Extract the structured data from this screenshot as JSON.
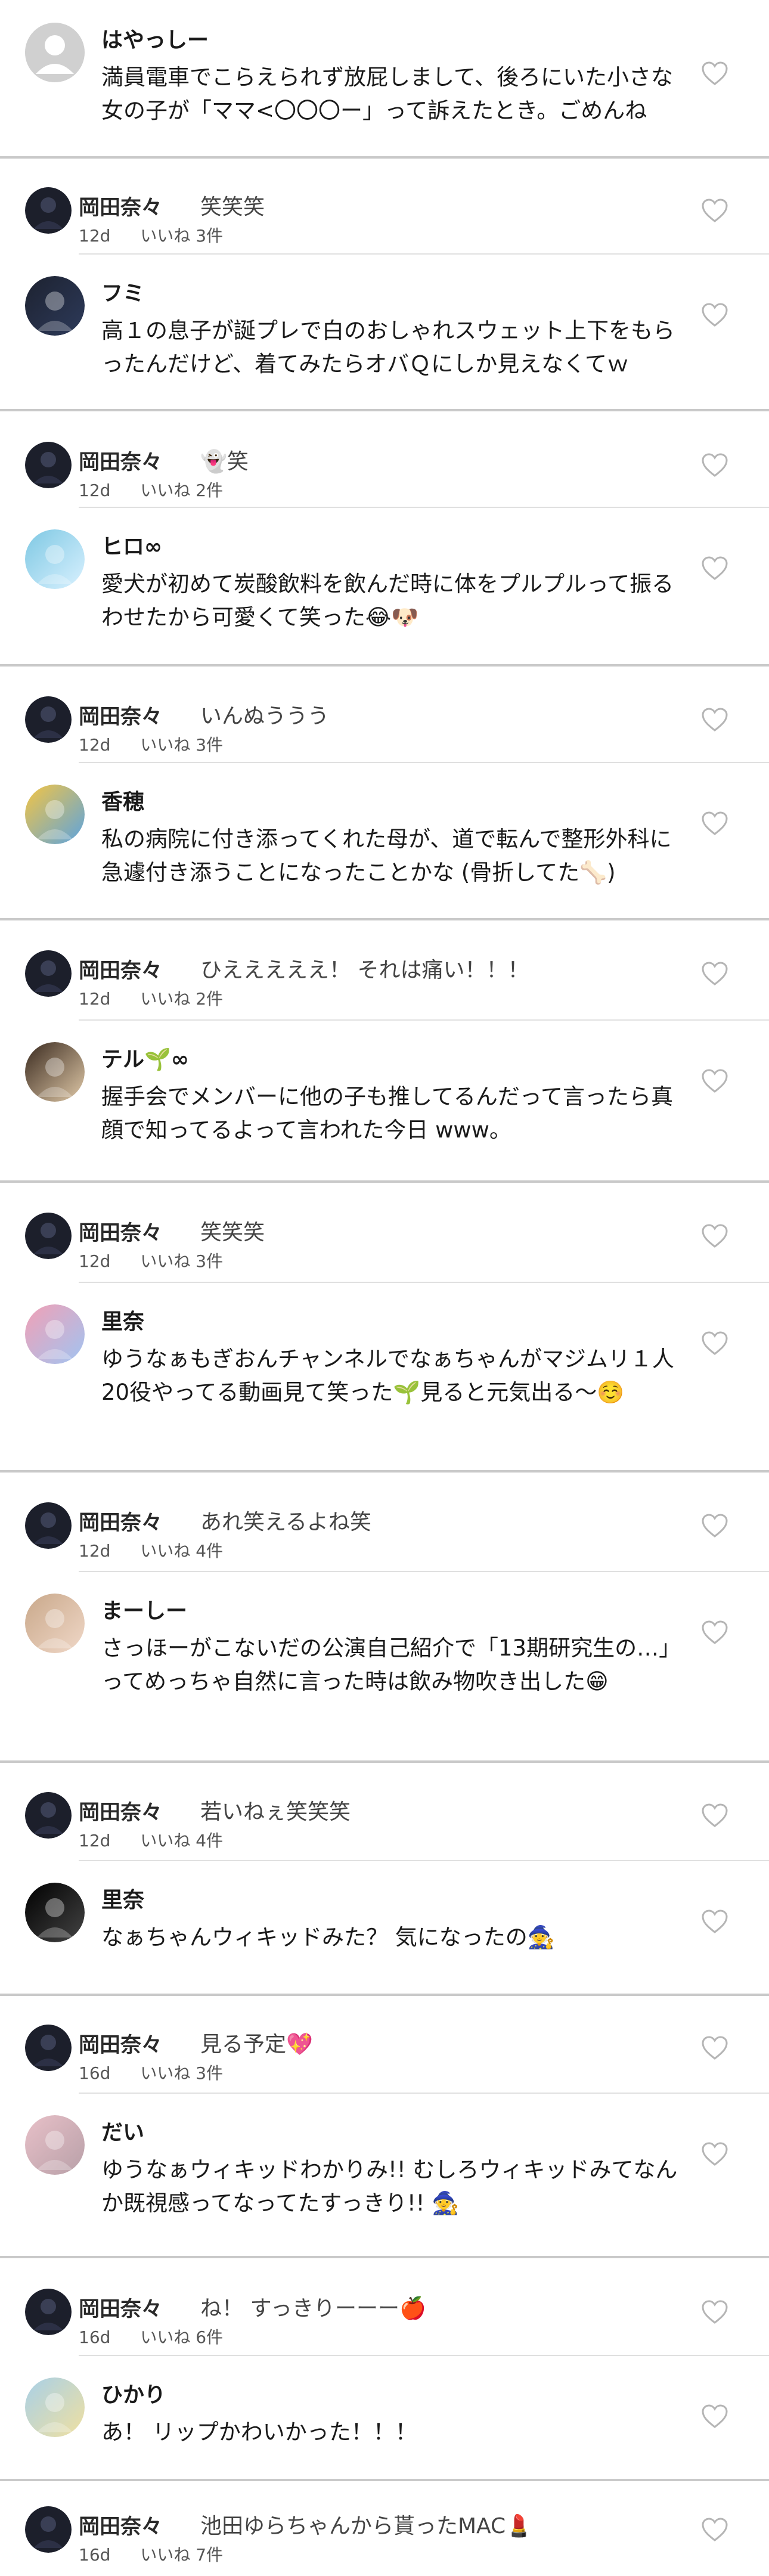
{
  "colors": {
    "separator": "#c9c9c9",
    "heart_outline": "#b5b5b5"
  },
  "threads": [
    {
      "comment": {
        "author": "はやっしー",
        "text": "満員電車でこらえられず放屁しまして、後ろにいた小さな女の子が「ママ<〇〇〇ー」って訴えたとき。ごめんね",
        "avatar": "default-avatar-icon"
      }
    },
    {
      "reply": {
        "author": "岡田奈々",
        "text": "笑笑笑",
        "date": "12d",
        "likes": "いいね 3件"
      },
      "comment": {
        "author": "フミ",
        "text": "高１の息子が誕プレで白のおしゃれスウェット上下をもらったんだけど、着てみたらオバＱにしか見えなくてｗ"
      }
    },
    {
      "reply": {
        "author": "岡田奈々",
        "text": "👻笑",
        "date": "12d",
        "likes": "いいね 2件"
      },
      "comment": {
        "author": "ヒロ∞",
        "text": "愛犬が初めて炭酸飲料を飲んだ時に体をプルプルって振るわせたから可愛くて笑った😂🐶"
      }
    },
    {
      "reply": {
        "author": "岡田奈々",
        "text": "いんぬううう",
        "date": "12d",
        "likes": "いいね 3件"
      },
      "comment": {
        "author": "香穂",
        "text": "私の病院に付き添ってくれた母が、道で転んで整形外科に急遽付き添うことになったことかな (骨折してた🦴)"
      }
    },
    {
      "reply": {
        "author": "岡田奈々",
        "text": "ひえええええ！ それは痛い！！！",
        "date": "12d",
        "likes": "いいね 2件"
      },
      "comment": {
        "author": "テル🌱∞",
        "text": "握手会でメンバーに他の子も推してるんだって言ったら真顔で知ってるよって言われた今日 www。"
      }
    },
    {
      "reply": {
        "author": "岡田奈々",
        "text": "笑笑笑",
        "date": "12d",
        "likes": "いいね 3件"
      },
      "comment": {
        "author": "里奈",
        "text": "ゆうなぁもぎおんチャンネルでなぁちゃんがマジムリ１人20役やってる動画見て笑った🌱見ると元気出る～☺️"
      }
    },
    {
      "reply": {
        "author": "岡田奈々",
        "text": "あれ笑えるよね笑",
        "date": "12d",
        "likes": "いいね 4件"
      },
      "comment": {
        "author": "まーしー",
        "text": "さっほーがこないだの公演自己紹介で「13期研究生の…」ってめっちゃ自然に言った時は飲み物吹き出した😁"
      }
    },
    {
      "reply": {
        "author": "岡田奈々",
        "text": "若いねぇ笑笑笑",
        "date": "12d",
        "likes": "いいね 4件"
      },
      "comment": {
        "author": "里奈",
        "text": "なぁちゃんウィキッドみた？ 気になったの🧙"
      }
    },
    {
      "reply": {
        "author": "岡田奈々",
        "text": "見る予定💖",
        "date": "16d",
        "likes": "いいね 3件"
      },
      "comment": {
        "author": "だい",
        "text": "ゆうなぁウィキッドわかりみ!! むしろウィキッドみてなんか既視感ってなってたすっきり!! 🧙"
      }
    },
    {
      "reply": {
        "author": "岡田奈々",
        "text": "ね！ すっきりーーー🍎",
        "date": "16d",
        "likes": "いいね 6件"
      },
      "comment": {
        "author": "ひかり",
        "text": "あ！ リップかわいかった！！！"
      }
    },
    {
      "reply": {
        "author": "岡田奈々",
        "text": "池田ゆらちゃんから貰ったMAC💄",
        "date": "16d",
        "likes": "いいね 7件"
      }
    }
  ]
}
